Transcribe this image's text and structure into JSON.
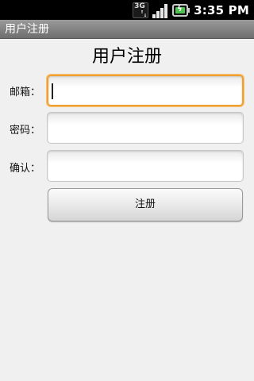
{
  "status_bar": {
    "network_label": "3G",
    "network_icon": "3g-data-icon",
    "signal_icon": "signal-strength-icon",
    "battery_icon": "battery-charging-icon",
    "time": "3:35 PM"
  },
  "title_bar": {
    "title": "用户注册"
  },
  "form": {
    "heading": "用户注册",
    "email_label": "邮箱：",
    "email_value": "",
    "password_label": "密码：",
    "password_value": "",
    "confirm_label": "确认：",
    "confirm_value": "",
    "submit_label": "注册",
    "focus_color": "#f0a030"
  }
}
